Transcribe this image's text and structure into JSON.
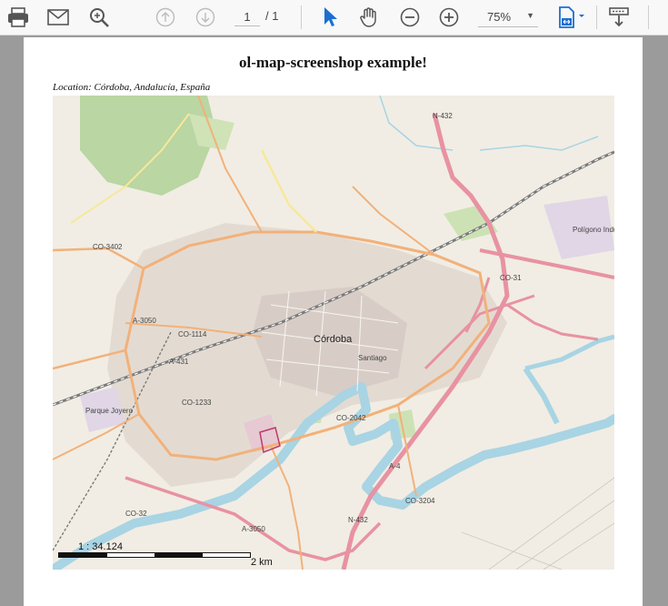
{
  "toolbar": {
    "page_current": "1",
    "page_total": "/ 1",
    "zoom": "75%",
    "accent_color": "#1b6fd1"
  },
  "document": {
    "title": "ol-map-screenshop example!",
    "location": "Location: Córdoba, Andalucía, España"
  },
  "map": {
    "scale_ratio": "1 : 34.124",
    "scale_end": "2 km",
    "labels": {
      "city": "Córdoba",
      "santiago": "Santiago",
      "co3402": "CO-3402",
      "a3050": "A-3050",
      "co1114": "CO-1114",
      "a431": "A-431",
      "co1233": "CO-1233",
      "co2042": "CO-2042",
      "a4": "A-4",
      "co3204": "CO-3204",
      "co32": "CO-32",
      "n432": "N-432",
      "n432b": "N-432",
      "a3050b": "A-3050",
      "co31": "CO-31",
      "parque": "Parque Joyero",
      "poligono": "Polígono Industrial"
    }
  }
}
